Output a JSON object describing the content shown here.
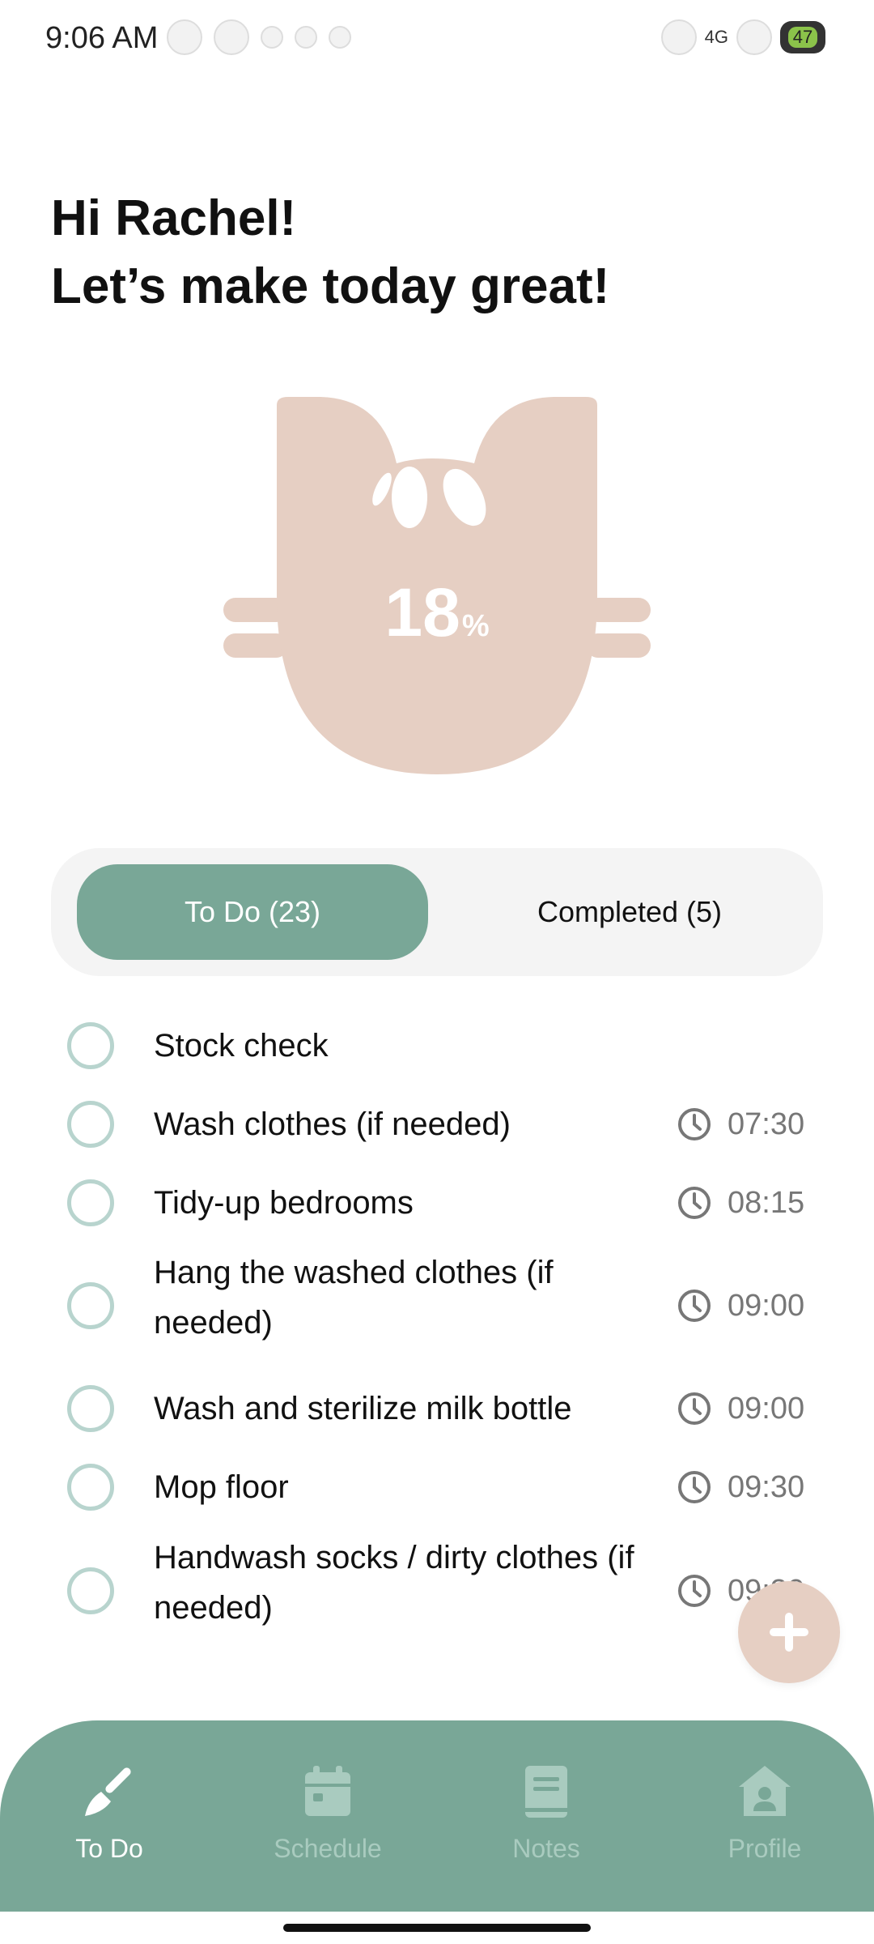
{
  "status_bar": {
    "time": "9:06 AM",
    "network": "4G",
    "battery": "47"
  },
  "greeting": {
    "line1": "Hi Rachel!",
    "line2": "Let’s make today great!"
  },
  "progress": {
    "percent_value": "18",
    "percent_unit": "%",
    "fraction": 0.18,
    "colors": {
      "fill": "#e6cfc3",
      "text": "#ffffff"
    }
  },
  "tabs": {
    "todo": "To Do (23)",
    "completed": "Completed (5)"
  },
  "tasks": [
    {
      "label": "Stock check",
      "time": ""
    },
    {
      "label": "Wash clothes (if needed)",
      "time": "07:30"
    },
    {
      "label": "Tidy-up bedrooms",
      "time": "08:15"
    },
    {
      "label": "Hang the washed clothes (if needed)",
      "time": "09:00"
    },
    {
      "label": "Wash and sterilize milk bottle",
      "time": "09:00"
    },
    {
      "label": "Mop floor",
      "time": "09:30"
    },
    {
      "label": "Handwash socks / dirty clothes (if needed)",
      "time": "09:30"
    }
  ],
  "fab": {
    "icon": "plus-icon"
  },
  "bottom_nav": {
    "items": [
      {
        "label": "To Do",
        "icon": "broom-icon",
        "active": true
      },
      {
        "label": "Schedule",
        "icon": "calendar-icon",
        "active": false
      },
      {
        "label": "Notes",
        "icon": "book-icon",
        "active": false
      },
      {
        "label": "Profile",
        "icon": "profile-icon",
        "active": false
      }
    ]
  },
  "colors": {
    "accent": "#79a797",
    "accent_light": "#a9cbbf",
    "check_ring": "#b8d4ce",
    "beige": "#e6cfc3",
    "tab_bg": "#f4f4f4"
  }
}
